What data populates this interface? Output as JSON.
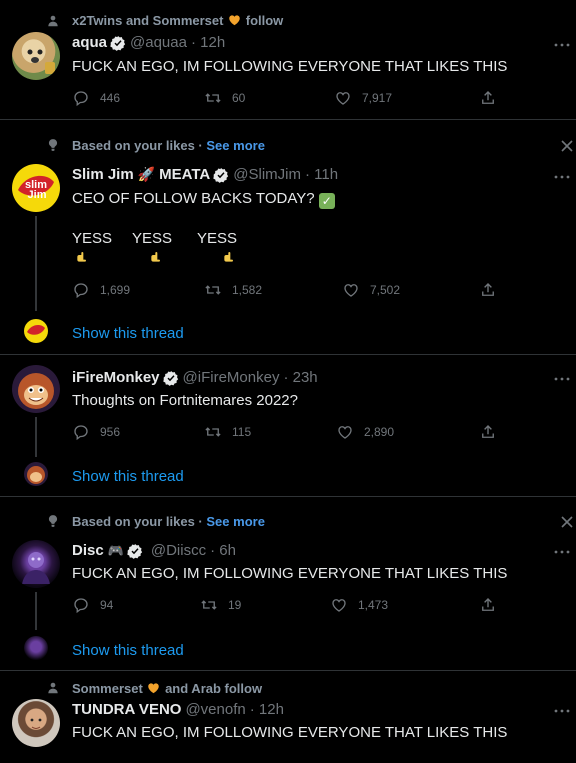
{
  "tweets": [
    {
      "context": {
        "names": "x2Twins and Sommerset",
        "suffix": "follow"
      },
      "display_name": "aqua",
      "handle": "@aquaa",
      "time": "· 12h",
      "text": "FUCK AN EGO, IM FOLLOWING EVERYONE THAT LIKES THIS",
      "replies": "446",
      "retweets": "60",
      "likes": "7,917"
    },
    {
      "context": {
        "label": "Based on your likes ·",
        "link": "See more"
      },
      "display_name": "Slim Jim",
      "name_suffix": "MEATA",
      "handle": "@SlimJim",
      "time": "· 11h",
      "text": "CEO OF FOLLOW BACKS TODAY?",
      "yess": [
        "YESS",
        "YESS",
        "YESS"
      ],
      "replies": "1,699",
      "retweets": "1,582",
      "likes": "7,502",
      "show_thread": "Show this thread"
    },
    {
      "display_name": "iFireMonkey",
      "handle": "@iFireMonkey",
      "time": "· 23h",
      "text": "Thoughts on Fortnitemares 2022?",
      "replies": "956",
      "retweets": "115",
      "likes": "2,890",
      "show_thread": "Show this thread"
    },
    {
      "context": {
        "label": "Based on your likes ·",
        "link": "See more"
      },
      "display_name": "Disc",
      "handle": "@Diiscc",
      "time": "· 6h",
      "text": "FUCK AN EGO, IM FOLLOWING EVERYONE THAT LIKES THIS",
      "replies": "94",
      "retweets": "19",
      "likes": "1,473",
      "show_thread": "Show this thread"
    },
    {
      "context": {
        "names": "Sommerset",
        "suffix": "and Arab follow"
      },
      "display_name": "TUNDRA VENO",
      "handle": "@venofn",
      "time": "· 12h",
      "text": "FUCK AN EGO, IM FOLLOWING EVERYONE THAT LIKES THIS"
    }
  ],
  "colors": {
    "accent": "#1d9bf0",
    "heart": "#f3a32c",
    "background": "#000000"
  },
  "icons": [
    "person-icon",
    "verified-icon",
    "reply-icon",
    "retweet-icon",
    "like-icon",
    "share-icon",
    "more-icon",
    "close-icon",
    "heart-emoji",
    "rocket-emoji",
    "check-emoji",
    "point-down-emoji",
    "gamepad-emoji"
  ]
}
